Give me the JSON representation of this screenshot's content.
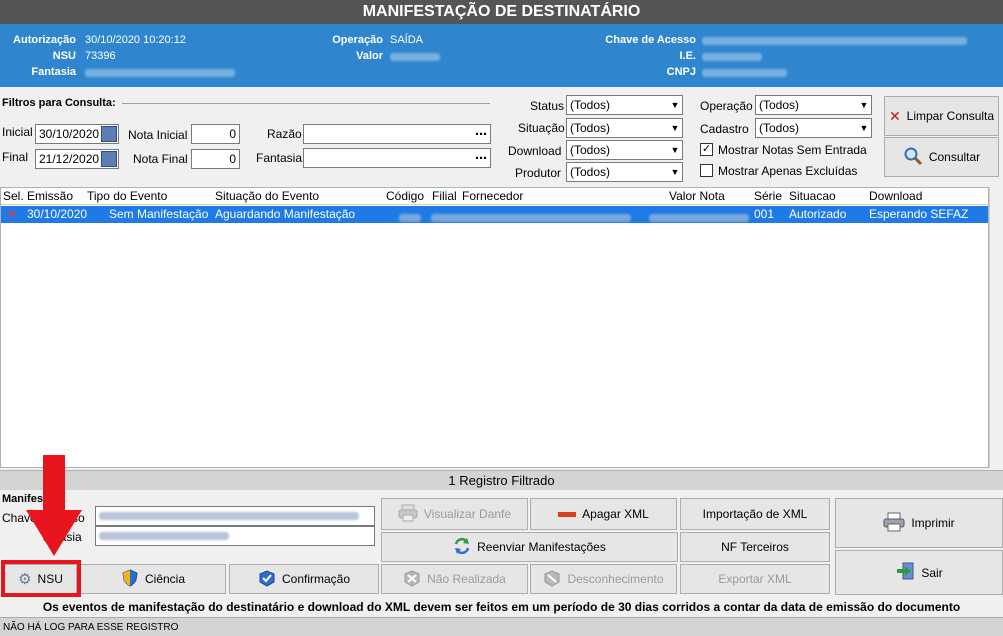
{
  "title": "MANIFESTAÇÃO DE DESTINATÁRIO",
  "header": {
    "autorizacao_label": "Autorização",
    "autorizacao_value": "30/10/2020 10:20:12",
    "nsu_label": "NSU",
    "nsu_value": "73396",
    "fantasia_label": "Fantasia",
    "operacao_label": "Operação",
    "operacao_value": "SAÍDA",
    "valor_label": "Valor",
    "chave_label": "Chave de Acesso",
    "ie_label": "I.E.",
    "cnpj_label": "CNPJ"
  },
  "filters": {
    "section_label": "Filtros para Consulta:",
    "inicial_label": "Inicial",
    "inicial_value": "30/10/2020",
    "final_label": "Final",
    "final_value": "21/12/2020",
    "nota_inicial_label": "Nota Inicial",
    "nota_inicial_value": "0",
    "nota_final_label": "Nota Final",
    "nota_final_value": "0",
    "razao_label": "Razão",
    "fantasia_label": "Fantasia",
    "status_label": "Status",
    "status_value": "(Todos)",
    "situacao_label": "Situação",
    "situacao_value": "(Todos)",
    "download_label": "Download",
    "download_value": "(Todos)",
    "produtor_label": "Produtor",
    "produtor_value": "(Todos)",
    "operacao_label": "Operação",
    "operacao_value": "(Todos)",
    "cadastro_label": "Cadastro",
    "cadastro_value": "(Todos)",
    "mostrar_sem_entrada": "Mostrar Notas Sem Entrada",
    "mostrar_excluidas": "Mostrar Apenas Excluídas",
    "limpar": "Limpar Consulta",
    "consultar": "Consultar",
    "ellipsis": "⋯"
  },
  "grid": {
    "columns": [
      "Sel.",
      "Emissão",
      "Tipo do Evento",
      "Situação do Evento",
      "Código",
      "Filial",
      "Fornecedor",
      "Valor Nota",
      "Série",
      "Situacao",
      "Download"
    ],
    "rows": [
      {
        "emissao": "30/10/2020",
        "tipo": "Sem Manifestação",
        "situacao_evento": "Aguardando Manifestação",
        "serie": "001",
        "situacao": "Autorizado",
        "download": "Esperando SEFAZ"
      }
    ]
  },
  "summary": "1 Registro Filtrado",
  "manifest": {
    "section_label": "Manifes",
    "chave_label": "Chave d",
    "chave_label_tail": "sso",
    "fantasia_label_tail": "antasia"
  },
  "buttons": {
    "visualizar_danfe": "Visualizar Danfe",
    "apagar_xml": "Apagar XML",
    "importacao_xml": "Importação de XML",
    "imprimir": "Imprimir",
    "reenviar": "Reenviar Manifestações",
    "nf_terceiros": "NF Terceiros",
    "nsu": "NSU",
    "ciencia": "Ciência",
    "confirmacao": "Confirmação",
    "nao_realizada": "Não Realizada",
    "desconhecimento": "Desconhecimento",
    "exportar_xml": "Exportar XML",
    "sair": "Sair"
  },
  "footer_message": "Os eventos de manifestação do destinatário e download do XML devem ser feitos em um período de 30 dias corridos a contar da data de emissão do documento",
  "status_bar": "NÃO HÁ LOG PARA ESSE REGISTRO"
}
